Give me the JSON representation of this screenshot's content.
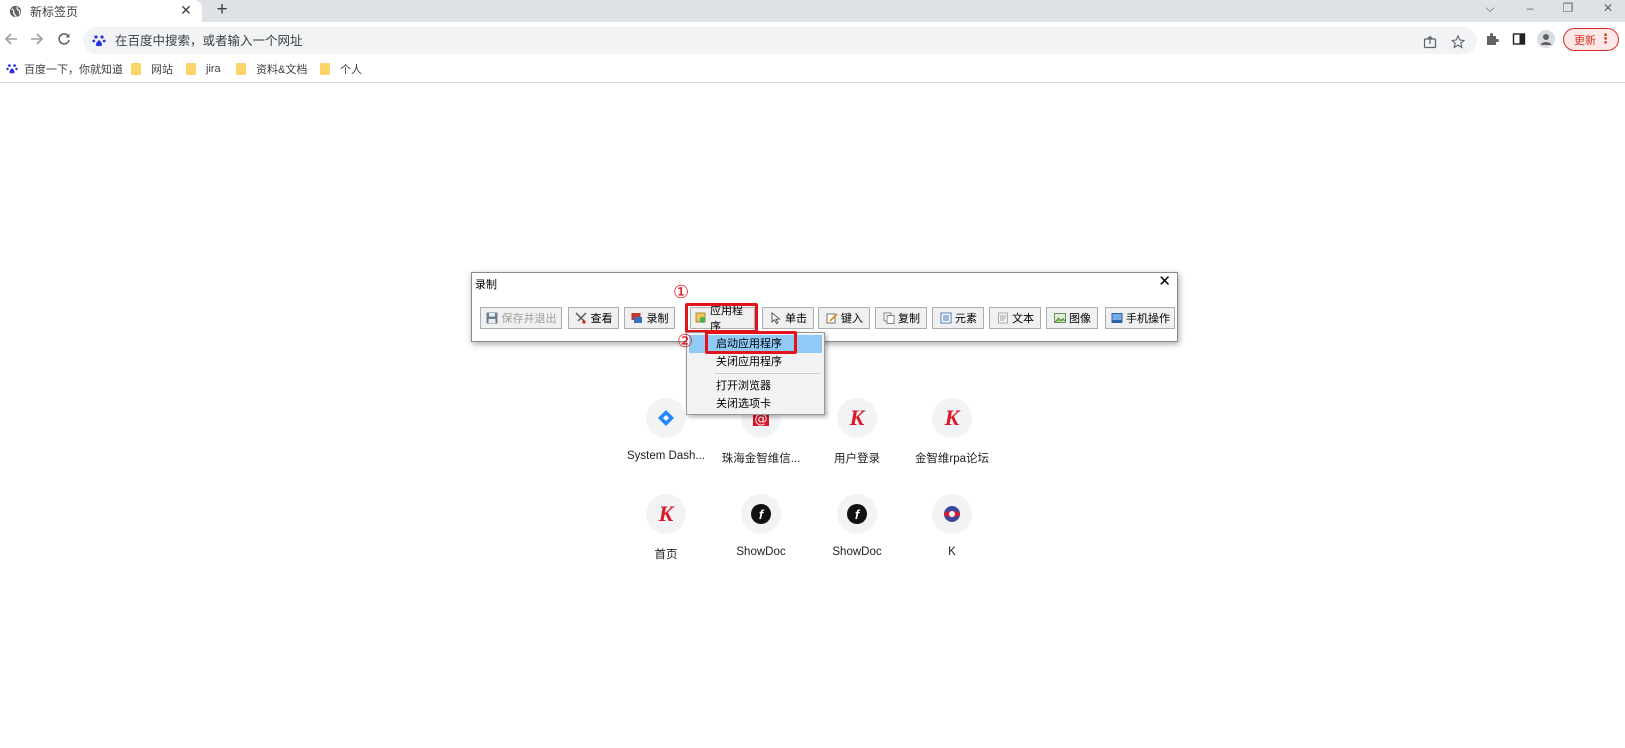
{
  "browser": {
    "tab": {
      "title": "新标签页",
      "close": "✕"
    },
    "new_tab": "+",
    "window_controls": {
      "list": "⌵",
      "minimize": "–",
      "restore": "❐",
      "close": "✕"
    },
    "omnibox": {
      "placeholder": "在百度中搜索，或者输入一个网址"
    },
    "update_button": {
      "label": "更新",
      "menu": "⋮"
    }
  },
  "bookmarks": [
    {
      "label": "百度一下，你就知道",
      "icon": "baidu-icon"
    },
    {
      "label": "网站",
      "icon": "folder-icon"
    },
    {
      "label": "jira",
      "icon": "folder-icon"
    },
    {
      "label": "资料&文档",
      "icon": "folder-icon"
    },
    {
      "label": "个人",
      "icon": "folder-icon"
    }
  ],
  "shortcuts": [
    {
      "label": "System Dash...",
      "icon": "jira-diamond-icon"
    },
    {
      "label": "珠海金智维信...",
      "icon": "mail-at-icon"
    },
    {
      "label": "用户登录",
      "icon": "k-logo-icon"
    },
    {
      "label": "金智维rpa论坛",
      "icon": "k-logo-icon"
    },
    {
      "label": "首页",
      "icon": "k-logo-icon"
    },
    {
      "label": "ShowDoc",
      "icon": "showdoc-icon"
    },
    {
      "label": "ShowDoc",
      "icon": "showdoc-icon"
    },
    {
      "label": "K",
      "icon": "k-circle-icon"
    }
  ],
  "recorder": {
    "title": "录制",
    "close": "✕",
    "buttons": [
      {
        "label": "保存并退出",
        "icon": "save-icon",
        "enabled": false
      },
      {
        "label": "查看",
        "icon": "view-icon",
        "enabled": true
      },
      {
        "label": "录制",
        "icon": "record-icon",
        "enabled": true
      },
      {
        "label": "应用程序",
        "icon": "app-icon",
        "enabled": true
      },
      {
        "label": "单击",
        "icon": "cursor-icon",
        "enabled": true
      },
      {
        "label": "键入",
        "icon": "type-icon",
        "enabled": true
      },
      {
        "label": "复制",
        "icon": "copy-icon",
        "enabled": true
      },
      {
        "label": "元素",
        "icon": "element-icon",
        "enabled": true
      },
      {
        "label": "文本",
        "icon": "text-icon",
        "enabled": true
      },
      {
        "label": "图像",
        "icon": "image-icon",
        "enabled": true
      },
      {
        "label": "手机操作",
        "icon": "phone-icon",
        "enabled": true
      }
    ],
    "annotations": {
      "step1": "①",
      "step2": "②"
    },
    "colors": {
      "highlight": "#e4131b",
      "selected": "#91c9f7"
    }
  },
  "dropdown": {
    "items": [
      {
        "label": "启动应用程序",
        "selected": true
      },
      {
        "label": "关闭应用程序",
        "selected": false
      },
      {
        "label": "打开浏览器",
        "selected": false
      },
      {
        "label": "关闭选项卡",
        "selected": false
      }
    ]
  }
}
